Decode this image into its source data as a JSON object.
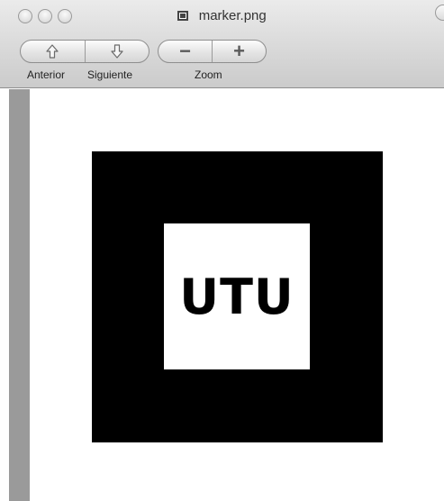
{
  "window": {
    "title": "marker.png"
  },
  "toolbar": {
    "prev_label": "Anterior",
    "next_label": "Siguiente",
    "zoom_label": "Zoom",
    "zoom_out_glyph": "−",
    "zoom_in_glyph": "+"
  },
  "image": {
    "marker_text": "UTU"
  },
  "icons": {
    "prev": "up-arrow-icon",
    "next": "down-arrow-icon",
    "doc": "image-document-icon"
  }
}
